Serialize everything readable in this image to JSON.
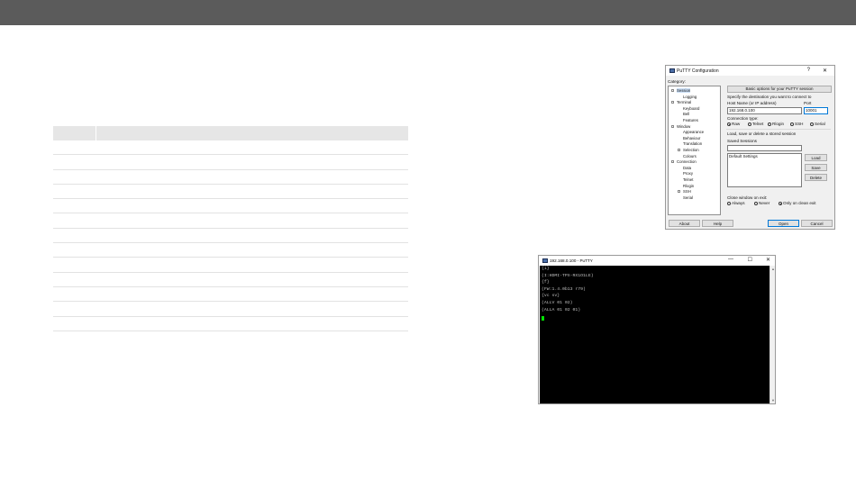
{
  "table": {
    "row_count": 13
  },
  "putty_config": {
    "title": "PuTTY Configuration",
    "help_glyph": "?",
    "close_glyph": "✕",
    "category_label": "Category:",
    "tree": [
      "Session",
      "Logging",
      "Terminal",
      "Keyboard",
      "Bell",
      "Features",
      "Window",
      "Appearance",
      "Behaviour",
      "Translation",
      "Selection",
      "Colours",
      "Connection",
      "Data",
      "Proxy",
      "Telnet",
      "Rlogin",
      "SSH",
      "Serial"
    ],
    "header_button": "Basic options for your PuTTY session",
    "destination_label": "Specify the destination you want to connect to",
    "host_label": "Host Name (or IP address)",
    "port_label": "Port",
    "host_value": "192.168.0.100",
    "port_value": "10001",
    "conn_type_label": "Connection type:",
    "conn_types": [
      "Raw",
      "Telnet",
      "Rlogin",
      "SSH",
      "Serial"
    ],
    "load_save_label": "Load, save or delete a stored session",
    "saved_sessions_label": "Saved Sessions",
    "sessions": [
      "Default Settings"
    ],
    "load_button": "Load",
    "save_button": "Save",
    "delete_button": "Delete",
    "close_exit_label": "Close window on exit:",
    "close_options": [
      "Always",
      "Never",
      "Only on clean exit"
    ],
    "about_button": "About",
    "help_button": "Help",
    "open_button": "Open",
    "cancel_button": "Cancel"
  },
  "putty_terminal": {
    "title": "192.168.0.100 - PuTTY",
    "minimize_glyph": "—",
    "maximize_glyph": "☐",
    "close_glyph": "✕",
    "lines": [
      "{i}",
      "(I:HDMI-TPX-RX1O1LE)",
      "{f}",
      "(FW:1.4.0b13 r79)",
      "{vc sv}",
      "(ALLV 01 02)",
      "(ALLA 01 02 01)"
    ]
  }
}
